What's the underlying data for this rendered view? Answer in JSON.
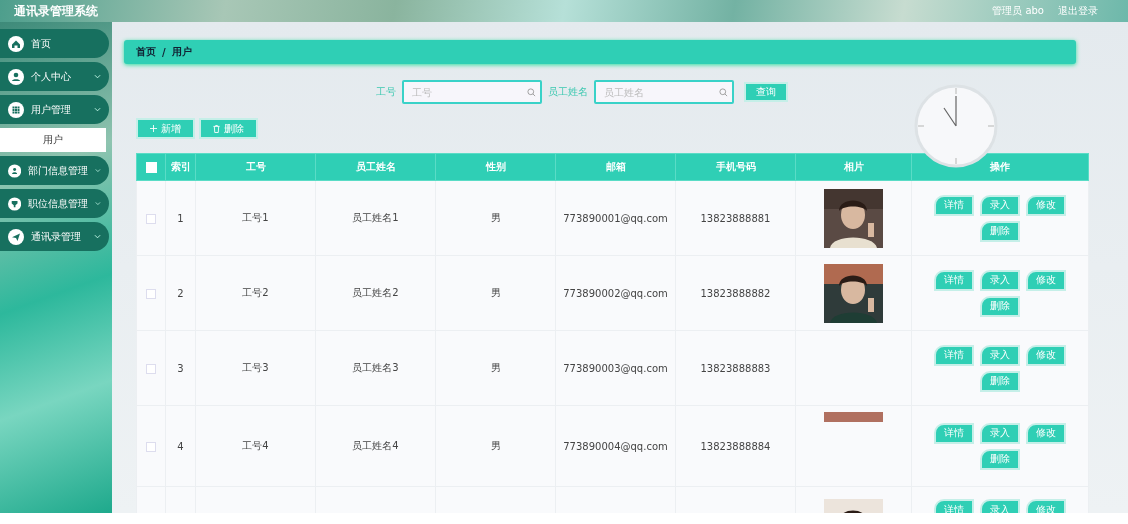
{
  "header": {
    "title": "通讯录管理系统",
    "user": "管理员 abo",
    "logout": "退出登录"
  },
  "sidebar": {
    "items": [
      {
        "label": "首页",
        "kind": "link"
      },
      {
        "label": "个人中心",
        "kind": "menu"
      },
      {
        "label": "用户管理",
        "kind": "menu",
        "children": [
          {
            "label": "用户",
            "selected": true
          }
        ]
      },
      {
        "label": "部门信息管理",
        "kind": "menu"
      },
      {
        "label": "职位信息管理",
        "kind": "menu"
      },
      {
        "label": "通讯录管理",
        "kind": "menu"
      }
    ]
  },
  "breadcrumb": {
    "items": [
      "首页",
      "用户"
    ],
    "separator": "/"
  },
  "search": {
    "fields": [
      {
        "label": "工号",
        "placeholder": "工号"
      },
      {
        "label": "员工姓名",
        "placeholder": "员工姓名"
      }
    ],
    "button": "查询"
  },
  "actions": [
    {
      "label": "新增",
      "kind": "add"
    },
    {
      "label": "删除",
      "kind": "delete"
    }
  ],
  "table": {
    "select_all": {
      "checked": false
    },
    "columns": [
      "索引",
      "工号",
      "员工姓名",
      "性别",
      "邮箱",
      "手机号码",
      "相片",
      "操作"
    ],
    "rows": [
      {
        "checked": false,
        "index": "1",
        "no": "工号1",
        "name": "员工姓名1",
        "gender": "男",
        "email": "773890001@qq.com",
        "phone": "13823888881",
        "photo": true,
        "photo_cropped": false,
        "buttons": [
          "详情",
          "录入",
          "修改",
          "删除"
        ]
      },
      {
        "checked": false,
        "index": "2",
        "no": "工号2",
        "name": "员工姓名2",
        "gender": "男",
        "email": "773890002@qq.com",
        "phone": "13823888882",
        "photo": true,
        "photo_cropped": false,
        "buttons": [
          "详情",
          "录入",
          "修改",
          "删除"
        ]
      },
      {
        "checked": false,
        "index": "3",
        "no": "工号3",
        "name": "员工姓名3",
        "gender": "男",
        "email": "773890003@qq.com",
        "phone": "13823888883",
        "photo": false,
        "buttons": [
          "详情",
          "录入",
          "修改",
          "删除"
        ]
      },
      {
        "checked": false,
        "index": "4",
        "no": "工号4",
        "name": "员工姓名4",
        "gender": "男",
        "email": "773890004@qq.com",
        "phone": "13823888884",
        "photo": true,
        "photo_cropped": true,
        "buttons": [
          "详情",
          "录入",
          "修改",
          "删除"
        ]
      },
      {
        "photo": true,
        "photo_cropped": false,
        "buttons": [
          "详情",
          "录入",
          "修改"
        ]
      }
    ]
  }
}
